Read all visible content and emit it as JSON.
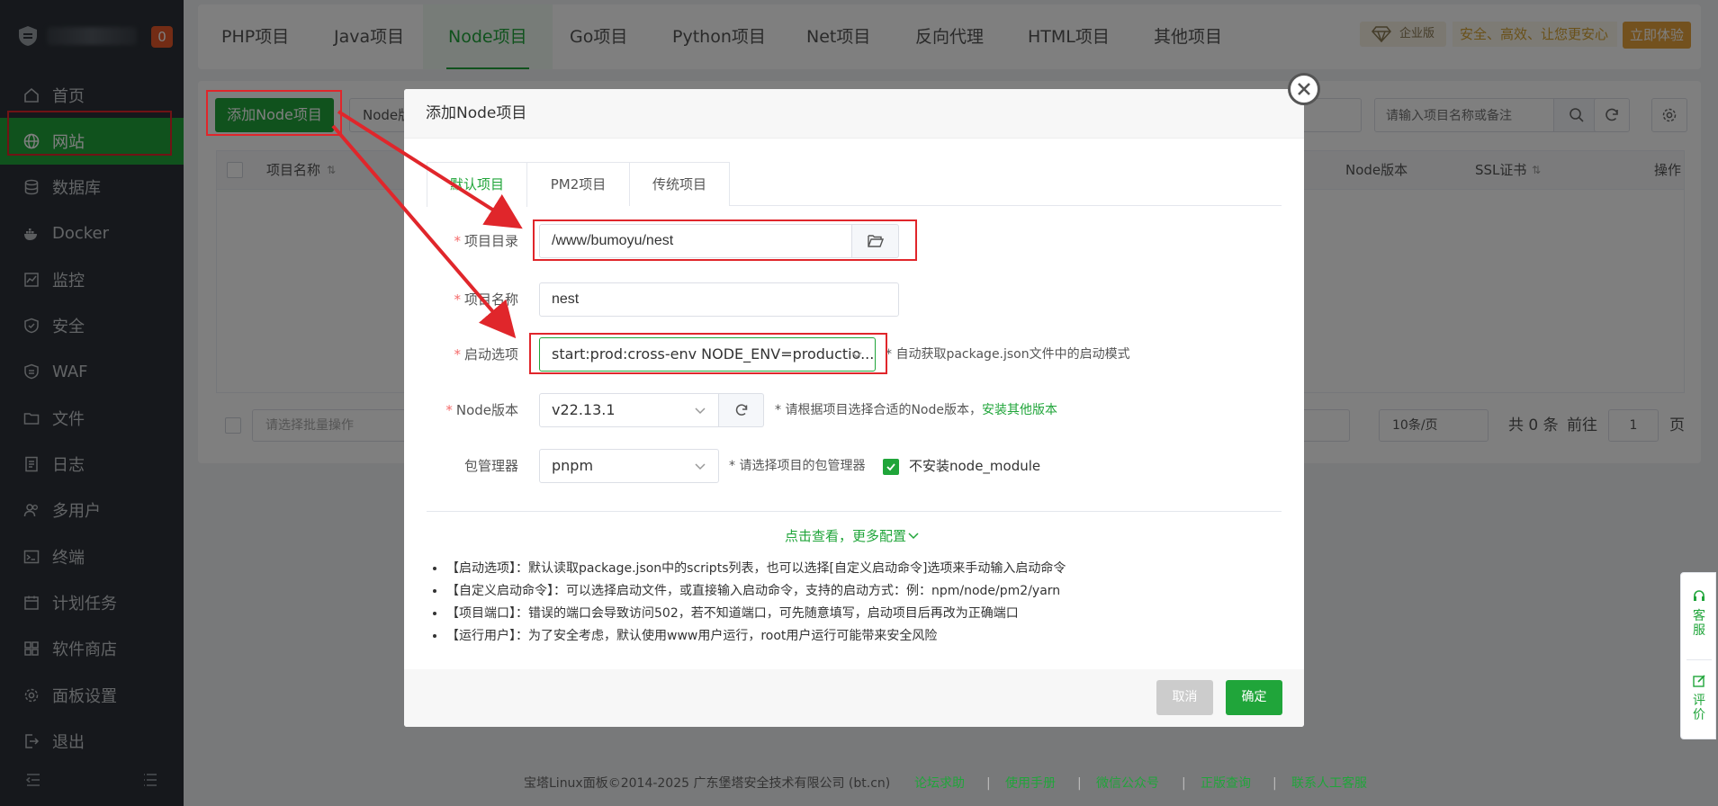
{
  "sidebar": {
    "badge": "0",
    "items": [
      {
        "label": "首页",
        "icon": "home-icon"
      },
      {
        "label": "网站",
        "icon": "globe-icon"
      },
      {
        "label": "数据库",
        "icon": "database-icon"
      },
      {
        "label": "Docker",
        "icon": "docker-icon"
      },
      {
        "label": "监控",
        "icon": "monitor-icon"
      },
      {
        "label": "安全",
        "icon": "shield-icon"
      },
      {
        "label": "WAF",
        "icon": "waf-icon"
      },
      {
        "label": "文件",
        "icon": "folder-icon"
      },
      {
        "label": "日志",
        "icon": "log-icon"
      },
      {
        "label": "多用户",
        "icon": "users-icon"
      },
      {
        "label": "终端",
        "icon": "terminal-icon"
      },
      {
        "label": "计划任务",
        "icon": "calendar-icon"
      },
      {
        "label": "软件商店",
        "icon": "grid-icon"
      },
      {
        "label": "面板设置",
        "icon": "gear-icon"
      },
      {
        "label": "退出",
        "icon": "logout-icon"
      }
    ]
  },
  "topbar": {
    "tabs": [
      "PHP项目",
      "Java项目",
      "Node项目",
      "Go项目",
      "Python项目",
      "Net项目",
      "反向代理",
      "HTML项目",
      "其他项目"
    ],
    "enterprise_label": "企业版",
    "enterprise_slogan": "安全、高效、让您更安心",
    "trial_button": "立即体验"
  },
  "panel": {
    "add_button": "添加Node项目",
    "filter_prefix": "Node版",
    "search_placeholder": "请输入项目名称或备注",
    "columns": {
      "name": "项目名称",
      "node_version": "Node版本",
      "ssl": "SSL证书",
      "actions": "操作"
    },
    "batch_placeholder": "请选择批量操作",
    "page_size": "10条/页",
    "total_text": "共 0 条",
    "goto_label": "前往",
    "page_number": "1",
    "page_suffix": "页"
  },
  "modal": {
    "title": "添加Node项目",
    "tabs": [
      "默认项目",
      "PM2项目",
      "传统项目"
    ],
    "fields": {
      "dir_label": "项目目录",
      "dir_value": "/www/bumoyu/nest",
      "name_label": "项目名称",
      "name_value": "nest",
      "start_label": "启动选项",
      "start_value": "start:prod:cross-env NODE_ENV=productio...",
      "start_hint": "* 自动获取package.json文件中的启动模式",
      "node_label": "Node版本",
      "node_value": "v22.13.1",
      "node_hint": "* 请根据项目选择合适的Node版本，",
      "node_hint_link": "安装其他版本",
      "pm_label": "包管理器",
      "pm_value": "pnpm",
      "pm_hint": "* 请选择项目的包管理器",
      "no_install_label": "不安装node_module"
    },
    "more_config": "点击查看，更多配置",
    "notes": [
      "【启动选项】：默认读取package.json中的scripts列表，也可以选择[自定义启动命令]选项来手动输入启动命令",
      "【自定义启动命令】：可以选择启动文件，或直接输入启动命令，支持的启动方式：例：npm/node/pm2/yarn",
      "【项目端口】：错误的端口会导致访问502，若不知道端口，可先随意填写，启动项目后再改为正确端口",
      "【运行用户】：为了安全考虑，默认使用www用户运行，root用户运行可能带来安全风险"
    ],
    "cancel": "取消",
    "ok": "确定"
  },
  "footer": {
    "copyright": "宝塔Linux面板©2014-2025 广东堡塔安全技术有限公司 (bt.cn)",
    "links": [
      "论坛求助",
      "使用手册",
      "微信公众号",
      "正版查询",
      "联系人工客服"
    ]
  },
  "float": {
    "service": "客服",
    "rate": "评价"
  },
  "colors": {
    "accent": "#20a53a",
    "annotation": "#e0262b",
    "sidebar": "#2c3138",
    "badge": "#e6582a",
    "trial": "#e6a23c"
  }
}
